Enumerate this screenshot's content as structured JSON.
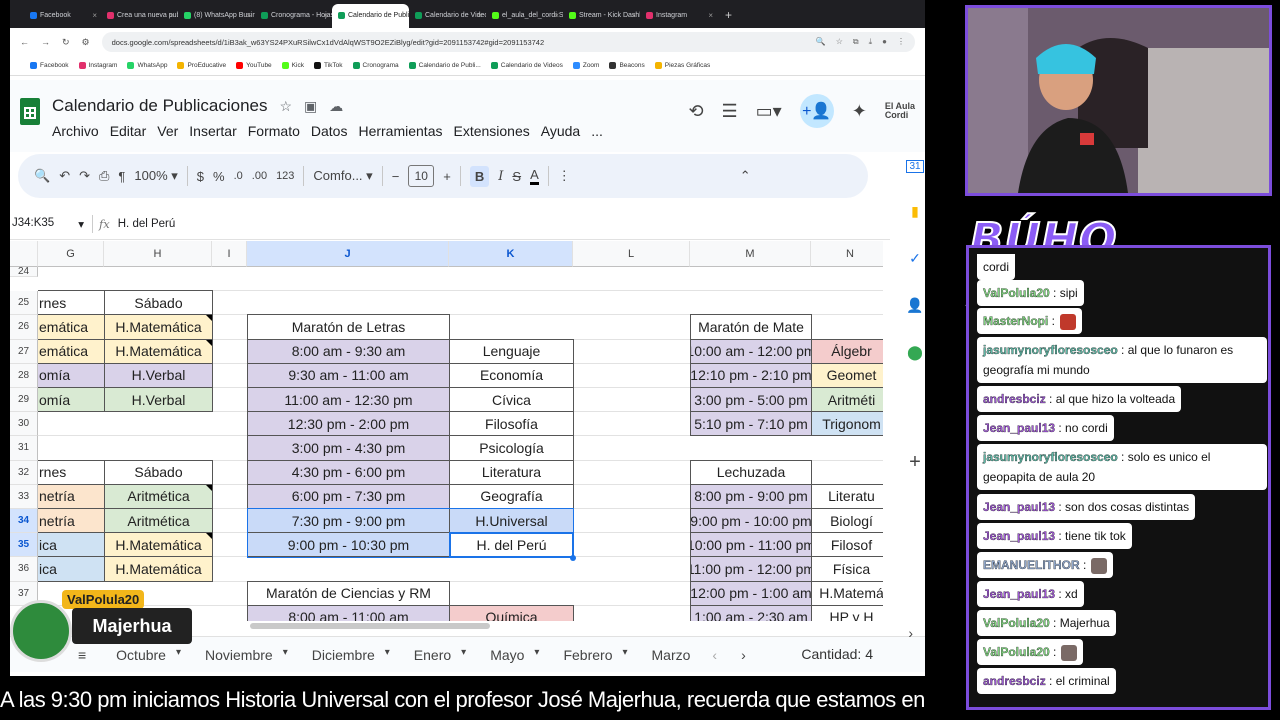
{
  "browser": {
    "tabs": [
      {
        "label": "Facebook",
        "color": "#1877f2"
      },
      {
        "label": "Crea una nueva publ",
        "color": "#e1306c"
      },
      {
        "label": "(8) WhatsApp Busine",
        "color": "#25d366"
      },
      {
        "label": "Cronograma - Hojas",
        "color": "#0f9d58"
      },
      {
        "label": "Calendario de Publi",
        "color": "#0f9d58",
        "active": true
      },
      {
        "label": "Calendario de Video",
        "color": "#0f9d58"
      },
      {
        "label": "el_aula_del_cordi Str",
        "color": "#53fc18"
      },
      {
        "label": "Stream - Kick Dashb",
        "color": "#53fc18"
      },
      {
        "label": "Instagram",
        "color": "#e1306c"
      }
    ],
    "url": "docs.google.com/spreadsheets/d/1iB3ak_w63YS24PXuRSilwCx1dVdAlqWST9O2EZiBlyg/edit?gid=2091153742#gid=2091153742",
    "bookmarks": [
      {
        "label": "Facebook",
        "color": "#1877f2"
      },
      {
        "label": "Instagram",
        "color": "#e1306c"
      },
      {
        "label": "WhatsApp",
        "color": "#25d366"
      },
      {
        "label": "ProEducative",
        "color": "#f4b400"
      },
      {
        "label": "YouTube",
        "color": "#ff0000"
      },
      {
        "label": "Kick",
        "color": "#53fc18"
      },
      {
        "label": "TikTok",
        "color": "#111111"
      },
      {
        "label": "Cronograma",
        "color": "#0f9d58"
      },
      {
        "label": "Calendario de Publi...",
        "color": "#0f9d58"
      },
      {
        "label": "Calendario de Videos",
        "color": "#0f9d58"
      },
      {
        "label": "Zoom",
        "color": "#2d8cff"
      },
      {
        "label": "Beacons",
        "color": "#333333"
      },
      {
        "label": "Piezas Gráficas",
        "color": "#f4b400"
      }
    ]
  },
  "sheets": {
    "title": "Calendario de Publicaciones",
    "menus": [
      "Archivo",
      "Editar",
      "Ver",
      "Insertar",
      "Formato",
      "Datos",
      "Herramientas",
      "Extensiones",
      "Ayuda",
      "..."
    ],
    "toolbar": {
      "zoom": "100%",
      "currency": "$",
      "percent": "%",
      "dec_less": ".0",
      "dec_more": ".00",
      "format": "123",
      "font": "Comfo...",
      "font_size": "10"
    },
    "namebox": "J34:K35",
    "formula": "H. del Perú",
    "columns": [
      {
        "label": "G"
      },
      {
        "label": "H"
      },
      {
        "label": "I"
      },
      {
        "label": "J",
        "sel": true
      },
      {
        "label": "K",
        "sel": true
      },
      {
        "label": "L"
      },
      {
        "label": "M"
      },
      {
        "label": "N"
      }
    ],
    "rows": [
      "24",
      "25",
      "26",
      "27",
      "28",
      "29",
      "30",
      "31",
      "32",
      "33",
      "34",
      "35",
      "36",
      "37"
    ],
    "cells": {
      "g25": "rnes",
      "h25": "Sábado",
      "g26": "emática",
      "h26": "H.Matemática",
      "g27": "emática",
      "h27": "H.Matemática",
      "g28": "omía",
      "h28": "H.Verbal",
      "g29": "omía",
      "h29": "H.Verbal",
      "g32": "rnes",
      "h32": "Sábado",
      "g33": "netría",
      "h33": "Aritmética",
      "g34": "netría",
      "h34": "Aritmética",
      "g35": "ica",
      "h35": "H.Matemática",
      "g36": "ica",
      "h36": "H.Matemática",
      "j26": "Maratón de Letras",
      "j27": "8:00 am - 9:30 am",
      "k27": "Lenguaje",
      "j28": "9:30 am - 11:00 am",
      "k28": "Economía",
      "j29": "11:00 am - 12:30 pm",
      "k29": "Cívica",
      "j30": "12:30 pm - 2:00 pm",
      "k30": "Filosofía",
      "j31": "3:00 pm - 4:30 pm",
      "k31": "Psicología",
      "j32": "4:30 pm - 6:00 pm",
      "k32": "Literatura",
      "j33": "6:00 pm - 7:30 pm",
      "k33": "Geografía",
      "j34": "7:30 pm - 9:00 pm",
      "k34": "H.Universal",
      "j35": "9:00 pm - 10:30 pm",
      "k35": "H. del Perú",
      "j37": "Maratón de Ciencias y RM",
      "j38": "8:00 am - 11:00 am",
      "k38": "Química",
      "m26": "Maratón de Mate",
      "m27": "10:00 am - 12:00 pm",
      "n27": "Álgebr",
      "m28": "12:10 pm - 2:10 pm",
      "n28": "Geomet",
      "m29": "3:00 pm - 5:00 pm",
      "n29": "Aritméti",
      "m30": "5:10 pm - 7:10 pm",
      "n30": "Trigonom",
      "m32": "Lechuzada",
      "m33": "8:00 pm - 9:00 pm",
      "n33": "Literatu",
      "m34": "9:00 pm - 10:00 pm",
      "n34": "Biologí",
      "m35": "10:00 pm - 11:00 pm",
      "n35": "Filosof",
      "m36": "11:00 pm - 12:00 pm",
      "n36": "Física",
      "m37": "12:00 pm - 1:00 am",
      "n37": "H.Matemá",
      "m38": "1:00 am - 2:30 am",
      "n38": "HP y H"
    },
    "sheet_tabs": [
      "Octubre",
      "Noviembre",
      "Diciembre",
      "Enero",
      "Mayo",
      "Febrero",
      "Marzo"
    ],
    "count": "Cantidad: 4"
  },
  "stream": {
    "chat_title": "BÚHO ARMY",
    "messages": [
      {
        "user": "",
        "text": "cordi",
        "ucolor": "#222"
      },
      {
        "user": "ValPolula20",
        "text": ": sipi",
        "ucolor": "#7fd37f"
      },
      {
        "user": "MasterNopi",
        "text": ":",
        "ucolor": "#7fd37f"
      },
      {
        "user": "jasumynoryfloresosceo",
        "text": ": al que lo funaron es geografía mi mundo",
        "ucolor": "#5fb8a6"
      },
      {
        "user": "andresbciz",
        "text": ": al que hizo la volteada",
        "ucolor": "#9b59d0"
      },
      {
        "user": "Jean_paul13",
        "text": ": no cordi",
        "ucolor": "#a15ad6"
      },
      {
        "user": "jasumynoryfloresosceo",
        "text": ": solo es unico el geopapita de aula 20",
        "ucolor": "#5fb8a6"
      },
      {
        "user": "Jean_paul13",
        "text": ": son dos cosas distintas",
        "ucolor": "#a15ad6"
      },
      {
        "user": "Jean_paul13",
        "text": ": tiene tik tok",
        "ucolor": "#a15ad6"
      },
      {
        "user": "EMANUELITHOR",
        "text": ":",
        "ucolor": "#8fa6c9"
      },
      {
        "user": "Jean_paul13",
        "text": ": xd",
        "ucolor": "#a15ad6"
      },
      {
        "user": "ValPolula20",
        "text": ": Majerhua",
        "ucolor": "#7fd37f"
      },
      {
        "user": "ValPolula20",
        "text": ":",
        "ucolor": "#7fd37f"
      },
      {
        "user": "andresbciz",
        "text": ": el criminal",
        "ucolor": "#9b59d0"
      }
    ],
    "badge_user": "ValPolula20",
    "badge_msg": "Majerhua",
    "ticker": "A las 9:30 pm iniciamos Historia Universal con el profesor José Majerhua, recuerda que estamos en"
  }
}
